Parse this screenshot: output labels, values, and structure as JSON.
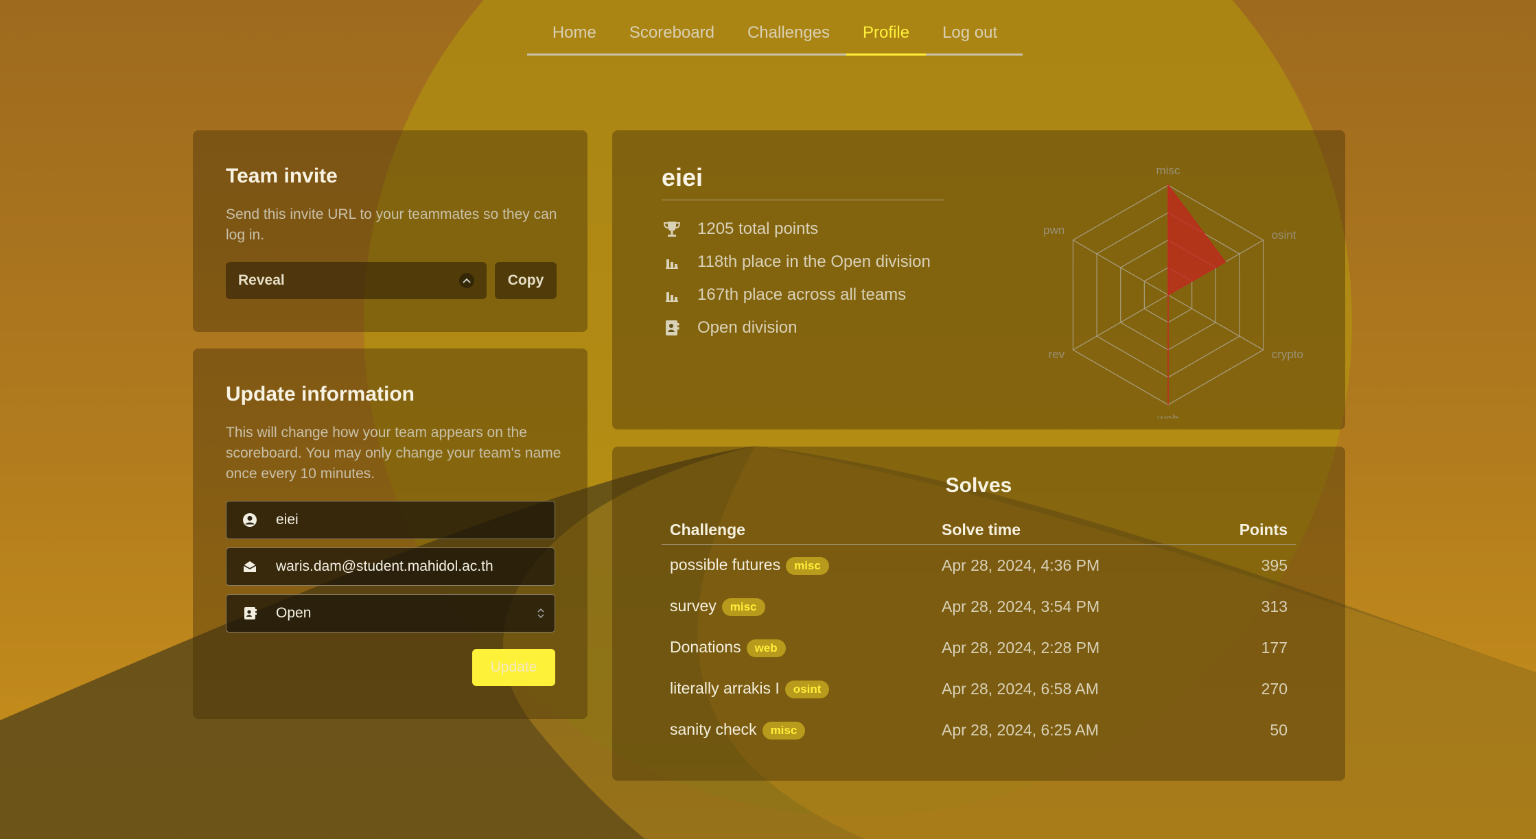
{
  "nav": {
    "items": [
      {
        "label": "Home",
        "active": false
      },
      {
        "label": "Scoreboard",
        "active": false
      },
      {
        "label": "Challenges",
        "active": false
      },
      {
        "label": "Profile",
        "active": true
      },
      {
        "label": "Log out",
        "active": false
      }
    ]
  },
  "team_invite": {
    "title": "Team invite",
    "description": "Send this invite URL to your teammates so they can log in.",
    "reveal_label": "Reveal",
    "copy_label": "Copy"
  },
  "update_info": {
    "title": "Update information",
    "description": "This will change how your team appears on the scoreboard. You may only change your team's name once every 10 minutes.",
    "name_value": "eiei",
    "email_value": "waris.dam@student.mahidol.ac.th",
    "division_value": "Open",
    "update_label": "Update",
    "icons": {
      "name": "user-circle-icon",
      "email": "envelope-open-icon",
      "division": "address-card-icon"
    }
  },
  "profile": {
    "team_name": "eiei",
    "stats": [
      {
        "icon": "trophy-icon",
        "text": "1205 total points"
      },
      {
        "icon": "bar-chart-icon",
        "text": "118th place in the Open division"
      },
      {
        "icon": "bar-chart-icon",
        "text": "167th place across all teams"
      },
      {
        "icon": "address-card-icon",
        "text": "Open division"
      }
    ]
  },
  "chart_data": {
    "type": "radar",
    "categories": [
      "misc",
      "osint",
      "crypto",
      "web",
      "rev",
      "pwn"
    ],
    "values": [
      1.0,
      0.6,
      0.0,
      0.0,
      0.0,
      0.0
    ],
    "rings": 4,
    "colors": {
      "fill": "#c0281e",
      "grid": "#a89e80",
      "label": "#9a9176"
    }
  },
  "solves": {
    "title": "Solves",
    "columns": [
      "Challenge",
      "Solve time",
      "Points"
    ],
    "rows": [
      {
        "challenge": "possible futures",
        "category": "misc",
        "time": "Apr 28, 2024, 4:36 PM",
        "points": "395"
      },
      {
        "challenge": "survey",
        "category": "misc",
        "time": "Apr 28, 2024, 3:54 PM",
        "points": "313"
      },
      {
        "challenge": "Donations",
        "category": "web",
        "time": "Apr 28, 2024, 2:28 PM",
        "points": "177"
      },
      {
        "challenge": "literally arrakis I",
        "category": "osint",
        "time": "Apr 28, 2024, 6:58 AM",
        "points": "270"
      },
      {
        "challenge": "sanity check",
        "category": "misc",
        "time": "Apr 28, 2024, 6:25 AM",
        "points": "50"
      }
    ]
  },
  "theme": {
    "accent": "#ffef3a",
    "tag_bg": "#b89a1c"
  }
}
